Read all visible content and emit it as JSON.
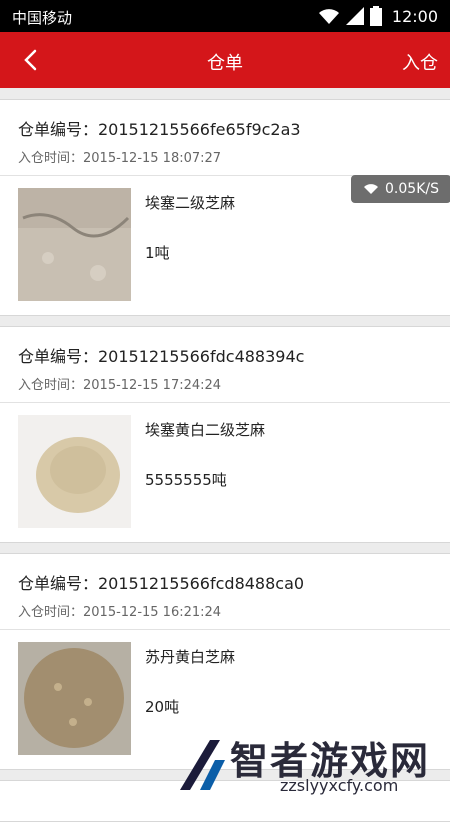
{
  "status_bar": {
    "carrier": "中国移动",
    "time": "12:00"
  },
  "app_bar": {
    "title": "仓单",
    "action": "入仓"
  },
  "network_speed": "0.05K/S",
  "orders": [
    {
      "no": "仓单编号：20151215566fe65f9c2a3",
      "time": "入仓时间：2015-12-15 18:07:27",
      "name": "埃塞二级芝麻",
      "qty": "1吨"
    },
    {
      "no": "仓单编号：20151215566fdc488394c",
      "time": "入仓时间：2015-12-15 17:24:24",
      "name": "埃塞黄白二级芝麻",
      "qty": "5555555吨"
    },
    {
      "no": "仓单编号：20151215566fcd8488ca0",
      "time": "入仓时间：2015-12-15 16:21:24",
      "name": "苏丹黄白芝麻",
      "qty": "20吨"
    }
  ],
  "watermark": {
    "name": "智者游戏网",
    "url": "zzslyyxcfy.com"
  }
}
